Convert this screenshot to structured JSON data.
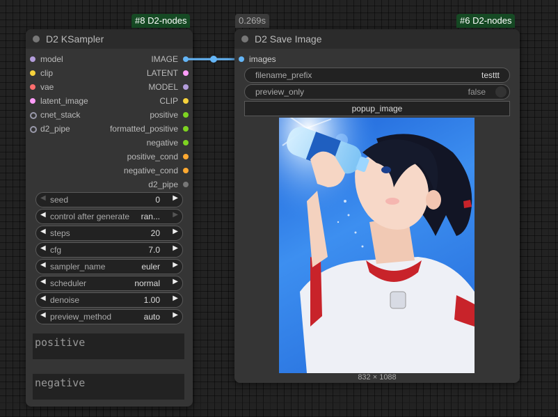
{
  "ksampler": {
    "badge": "#8 D2-nodes",
    "title": "D2 KSampler",
    "inputs": [
      {
        "label": "model",
        "color": "#b39ddb",
        "hollow": false
      },
      {
        "label": "clip",
        "color": "#f6d23c",
        "hollow": false
      },
      {
        "label": "vae",
        "color": "#ff6e6e",
        "hollow": false
      },
      {
        "label": "latent_image",
        "color": "#ff9cf9",
        "hollow": false
      },
      {
        "label": "cnet_stack",
        "color": "#99a",
        "hollow": true
      },
      {
        "label": "d2_pipe",
        "color": "#99a",
        "hollow": true
      }
    ],
    "outputs": [
      {
        "label": "IMAGE",
        "color": "#64b5f6"
      },
      {
        "label": "LATENT",
        "color": "#ff9cf9"
      },
      {
        "label": "MODEL",
        "color": "#b39ddb"
      },
      {
        "label": "CLIP",
        "color": "#f6d23c"
      },
      {
        "label": "positive",
        "color": "#7ed321"
      },
      {
        "label": "formatted_positive",
        "color": "#7ed321"
      },
      {
        "label": "negative",
        "color": "#7ed321"
      },
      {
        "label": "positive_cond",
        "color": "#ffa931"
      },
      {
        "label": "negative_cond",
        "color": "#ffa931"
      },
      {
        "label": "d2_pipe",
        "color": "#777"
      }
    ],
    "widgets": [
      {
        "label": "seed",
        "value": "0",
        "dim_left": true
      },
      {
        "label": "control after generate",
        "value": "ran...",
        "dim_right": true
      },
      {
        "label": "steps",
        "value": "20"
      },
      {
        "label": "cfg",
        "value": "7.0"
      },
      {
        "label": "sampler_name",
        "value": "euler"
      },
      {
        "label": "scheduler",
        "value": "normal"
      },
      {
        "label": "denoise",
        "value": "1.00"
      },
      {
        "label": "preview_method",
        "value": "auto"
      }
    ],
    "positive_placeholder": "positive",
    "negative_placeholder": "negative"
  },
  "save_image": {
    "time_badge": "0.269s",
    "badge": "#6 D2-nodes",
    "title": "D2 Save Image",
    "input_label": "images",
    "input_color": "#64b5f6",
    "filename_prefix_label": "filename_prefix",
    "filename_prefix_value": "testtt",
    "preview_only_label": "preview_only",
    "preview_only_value": "false",
    "popup_button": "popup_image",
    "image_size": "832 × 1088"
  },
  "link_color": "#64b5f6"
}
